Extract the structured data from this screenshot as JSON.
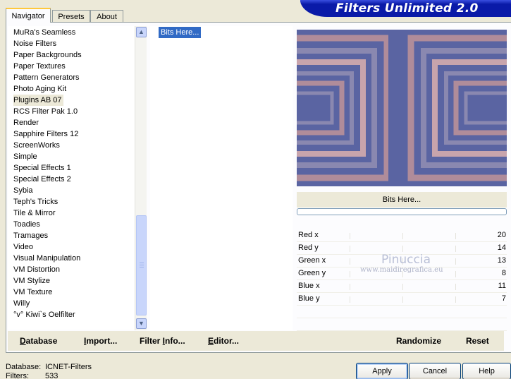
{
  "tabs": [
    {
      "label": "Navigator",
      "active": true
    },
    {
      "label": "Presets",
      "active": false
    },
    {
      "label": "About",
      "active": false
    }
  ],
  "banner": {
    "title": "Filters Unlimited 2.0"
  },
  "categories": {
    "items": [
      "MuRa's Seamless",
      "Noise Filters",
      "Paper Backgrounds",
      "Paper Textures",
      "Pattern Generators",
      "Photo Aging Kit",
      "Plugins AB 07",
      "RCS Filter Pak 1.0",
      "Render",
      "Sapphire Filters 12",
      "ScreenWorks",
      "Simple",
      "Special Effects 1",
      "Special Effects 2",
      "Sybia",
      "Teph's Tricks",
      "Tile & Mirror",
      "Toadies",
      "Tramages",
      "Video",
      "Visual Manipulation",
      "VM Distortion",
      "VM Stylize",
      "VM Texture",
      "Willy",
      "°v° Kiwi`s Oelfilter"
    ],
    "selected": "Plugins AB 07"
  },
  "filters": {
    "items": [
      "Bits Here..."
    ],
    "selected": "Bits Here..."
  },
  "preview": {
    "filter_name": "Bits Here...",
    "colors": {
      "blue": "#5a64a2",
      "rose": "#b08c9a",
      "pink": "#c8a4ac",
      "slate": "#8a88b0"
    }
  },
  "params": [
    {
      "label": "Red x",
      "value": "20"
    },
    {
      "label": "Red y",
      "value": "14"
    },
    {
      "label": "Green x",
      "value": "13"
    },
    {
      "label": "Green y",
      "value": "8"
    },
    {
      "label": "Blue x",
      "value": "11"
    },
    {
      "label": "Blue y",
      "value": "7"
    }
  ],
  "watermark": {
    "name": "Pinuccia",
    "site": "www.maidiregrafica.eu"
  },
  "toolbar": {
    "database": "atabase",
    "database_key": "D",
    "import": "mport...",
    "import_prefix": "I",
    "filter_info_prefix": "Filter ",
    "filter_info_key": "I",
    "filter_info_rest": "nfo...",
    "editor_key": "E",
    "editor_rest": "ditor...",
    "randomize": "Randomize",
    "reset": "Reset"
  },
  "status": {
    "database_label": "Database:",
    "database_value": "ICNET-Filters",
    "filters_label": "Filters:",
    "filters_value": "533"
  },
  "buttons": {
    "apply": "Apply",
    "cancel": "Cancel",
    "help": "Help"
  }
}
